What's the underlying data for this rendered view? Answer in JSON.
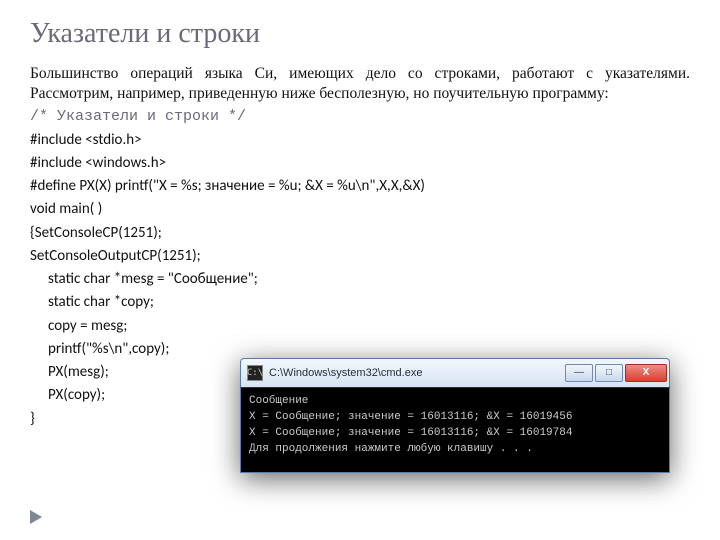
{
  "title": "Указатели и строки",
  "body": "Большинство операций языка Си, имеющих дело со строками, работают с указателями. Рассмотрим, например, приведенную ниже бесполезную, но поучительную программу:",
  "comment": "/* Указатели и строки */",
  "code": {
    "l1": "#include <stdio.h>",
    "l2": "#include <windows.h>",
    "l3": "#define PX(X) printf(\"X = %s; значение = %u; &X = %u\\n\",X,X,&X)",
    "l4": "void main( )",
    "l5": "{SetConsoleCP(1251);",
    "l6": "SetConsoleOutputCP(1251);",
    "l7": "static char *mesg = \"Сообщение\";",
    "l8": "static char *copy;",
    "l9": "copy = mesg;",
    "l10": "printf(\"%s\\n\",copy);",
    "l11": "PX(mesg);",
    "l12": "PX(copy);",
    "l13": "}"
  },
  "console": {
    "title": "C:\\Windows\\system32\\cmd.exe",
    "icon": "C:\\",
    "minimize": "—",
    "maximize": "□",
    "close": "X",
    "out1": "Сообщение",
    "out2": "X = Сообщение; значение = 16013116; &X = 16019456",
    "out3": "X = Сообщение; значение = 16013116; &X = 16019784",
    "out4": "Для продолжения нажмите любую клавишу . . ."
  }
}
